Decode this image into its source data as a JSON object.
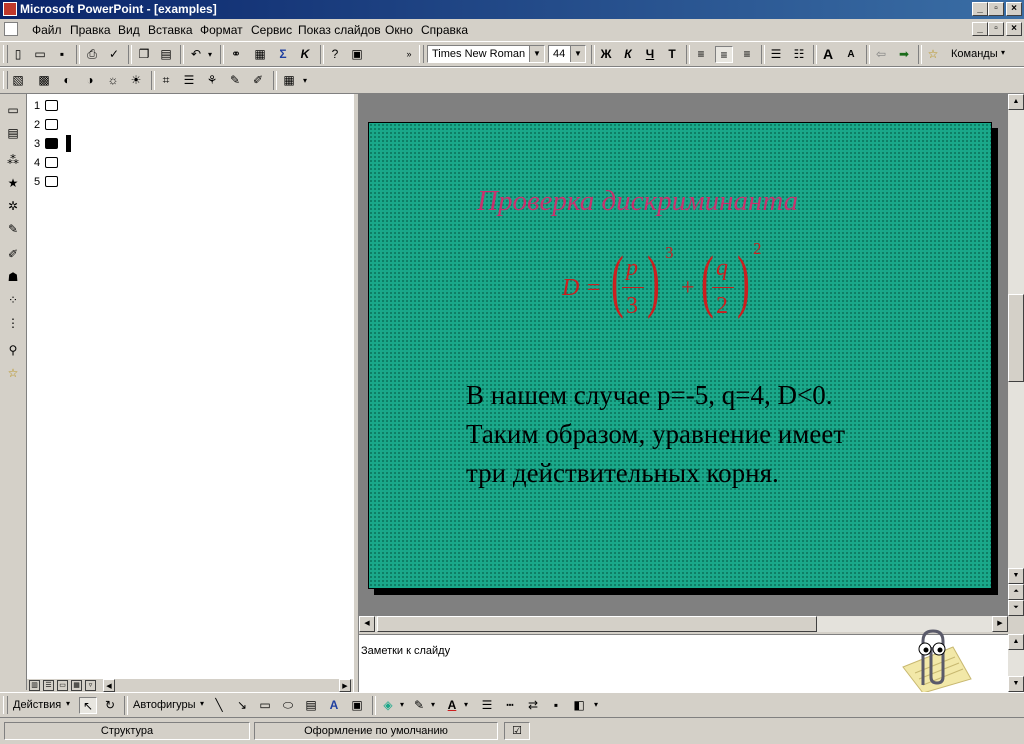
{
  "window": {
    "title": "Microsoft PowerPoint - [examples]"
  },
  "menu": [
    "Файл",
    "Правка",
    "Вид",
    "Вставка",
    "Формат",
    "Сервис",
    "Показ слайдов",
    "Окно",
    "Справка"
  ],
  "formatting": {
    "font": "Times New Roman",
    "size": "44",
    "bold": "Ж",
    "italic": "К",
    "underline": "Ч",
    "commands": "Команды"
  },
  "outline": {
    "slides": [
      "1",
      "2",
      "3",
      "4",
      "5"
    ],
    "selected": 3
  },
  "slide": {
    "title": "Проверка дискриминанта",
    "formula": {
      "lhs": "D =",
      "t1_num": "p",
      "t1_den": "3",
      "t1_exp": "3",
      "plus": "+",
      "t2_num": "q",
      "t2_den": "2",
      "t2_exp": "2"
    },
    "body": [
      "В нашем случае p=-5, q=4, D<0.",
      "Таким образом, уравнение имеет",
      "три действительных корня."
    ]
  },
  "notes": {
    "placeholder": "Заметки к слайду"
  },
  "drawing": {
    "actions": "Действия",
    "autoshapes": "Автофигуры"
  },
  "status": {
    "view": "Структура",
    "design": "Оформление по умолчанию"
  },
  "colors": {
    "slide_bg": "#1aa88a",
    "title": "#c8326e",
    "formula": "#cc1f1f",
    "titlebar": "#0a246a"
  }
}
